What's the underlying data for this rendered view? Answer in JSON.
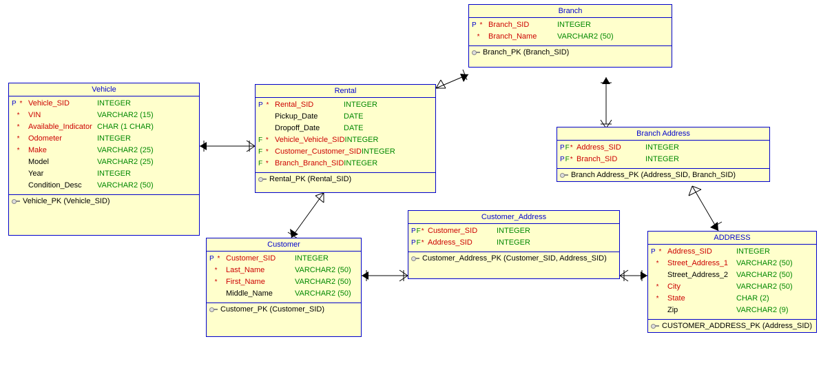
{
  "entities": {
    "vehicle": {
      "title": "Vehicle",
      "columns": [
        {
          "flags": "P *",
          "name": "Vehicle_SID",
          "type": "INTEGER",
          "req": true
        },
        {
          "flags": "  *",
          "name": "VIN",
          "type": "VARCHAR2 (15)",
          "req": true
        },
        {
          "flags": "  *",
          "name": "Available_Indicator",
          "type": "CHAR (1 CHAR)",
          "req": true
        },
        {
          "flags": "  *",
          "name": "Odometer",
          "type": "INTEGER",
          "req": true
        },
        {
          "flags": "  *",
          "name": "Make",
          "type": "VARCHAR2 (25)",
          "req": true
        },
        {
          "flags": "   ",
          "name": "Model",
          "type": "VARCHAR2 (25)",
          "req": false
        },
        {
          "flags": "   ",
          "name": "Year",
          "type": "INTEGER",
          "req": false
        },
        {
          "flags": "   ",
          "name": "Condition_Desc",
          "type": "VARCHAR2 (50)",
          "req": false
        }
      ],
      "pk": "Vehicle_PK (Vehicle_SID)"
    },
    "rental": {
      "title": "Rental",
      "columns": [
        {
          "flags": "P *",
          "name": "Rental_SID",
          "type": "INTEGER",
          "req": true
        },
        {
          "flags": "   ",
          "name": "Pickup_Date",
          "type": "DATE",
          "req": false
        },
        {
          "flags": "   ",
          "name": "Dropoff_Date",
          "type": "DATE",
          "req": false
        },
        {
          "flags": "F *",
          "name": "Vehicle_Vehicle_SID",
          "type": "INTEGER",
          "req": true
        },
        {
          "flags": "F *",
          "name": "Customer_Customer_SID",
          "type": "INTEGER",
          "req": true
        },
        {
          "flags": "F *",
          "name": "Branch_Branch_SID",
          "type": "INTEGER",
          "req": true
        }
      ],
      "pk": "Rental_PK (Rental_SID)"
    },
    "branch": {
      "title": "Branch",
      "columns": [
        {
          "flags": "P *",
          "name": "Branch_SID",
          "type": "INTEGER",
          "req": true
        },
        {
          "flags": "  *",
          "name": "Branch_Name",
          "type": "VARCHAR2 (50)",
          "req": true
        }
      ],
      "pk": "Branch_PK (Branch_SID)"
    },
    "branchAddress": {
      "title": "Branch Address",
      "columns": [
        {
          "flags": "PF*",
          "name": "Address_SID",
          "type": "INTEGER",
          "req": true
        },
        {
          "flags": "PF*",
          "name": "Branch_SID",
          "type": "INTEGER",
          "req": true
        }
      ],
      "pk": "Branch Address_PK (Address_SID, Branch_SID)"
    },
    "customer": {
      "title": "Customer",
      "columns": [
        {
          "flags": "P *",
          "name": "Customer_SID",
          "type": "INTEGER",
          "req": true
        },
        {
          "flags": "  *",
          "name": "Last_Name",
          "type": "VARCHAR2 (50)",
          "req": true
        },
        {
          "flags": "  *",
          "name": "First_Name",
          "type": "VARCHAR2 (50)",
          "req": true
        },
        {
          "flags": "   ",
          "name": "Middle_Name",
          "type": "VARCHAR2 (50)",
          "req": false
        }
      ],
      "pk": "Customer_PK (Customer_SID)"
    },
    "customerAddress": {
      "title": "Customer_Address",
      "columns": [
        {
          "flags": "PF*",
          "name": "Customer_SID",
          "type": "INTEGER",
          "req": true
        },
        {
          "flags": "PF*",
          "name": "Address_SID",
          "type": "INTEGER",
          "req": true
        }
      ],
      "pk": "Customer_Address_PK (Customer_SID, Address_SID)"
    },
    "address": {
      "title": "ADDRESS",
      "columns": [
        {
          "flags": "P *",
          "name": "Address_SID",
          "type": "INTEGER",
          "req": true
        },
        {
          "flags": "  *",
          "name": "Street_Address_1",
          "type": "VARCHAR2 (50)",
          "req": true
        },
        {
          "flags": "   ",
          "name": "Street_Address_2",
          "type": "VARCHAR2 (50)",
          "req": false
        },
        {
          "flags": "  *",
          "name": "City",
          "type": "VARCHAR2 (50)",
          "req": true
        },
        {
          "flags": "  *",
          "name": "State",
          "type": "CHAR (2)",
          "req": true
        },
        {
          "flags": "   ",
          "name": "Zip",
          "type": "VARCHAR2 (9)",
          "req": false
        }
      ],
      "pk": "CUSTOMER_ADDRESS_PK (Address_SID)"
    }
  }
}
